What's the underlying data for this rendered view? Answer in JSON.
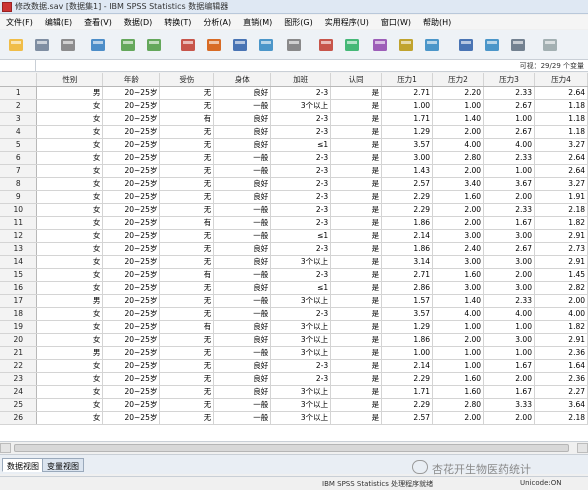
{
  "window": {
    "title": "修改数据.sav [数据集1] - IBM SPSS Statistics 数据编辑器"
  },
  "menu": [
    "文件(F)",
    "编辑(E)",
    "查看(V)",
    "数据(D)",
    "转换(T)",
    "分析(A)",
    "直销(M)",
    "图形(G)",
    "实用程序(U)",
    "窗口(W)",
    "帮助(H)"
  ],
  "toolbar": {
    "icons": [
      "open-icon",
      "save-icon",
      "print-icon",
      "dialog-recall-icon",
      "undo-icon",
      "redo-icon",
      "goto-case-icon",
      "goto-variable-icon",
      "variables-icon",
      "run-descriptives-icon",
      "find-icon",
      "insert-cases-icon",
      "insert-variable-icon",
      "split-file-icon",
      "weight-cases-icon",
      "select-cases-icon",
      "value-labels-icon",
      "use-sets-icon",
      "show-all-variables-icon",
      "spell-check-icon"
    ]
  },
  "infobar": {
    "visible_text": "可视：29/29 个变量"
  },
  "grid": {
    "columns": [
      "性别",
      "年龄",
      "受伤",
      "身体",
      "加班",
      "认同",
      "压力1",
      "压力2",
      "压力3",
      "压力4"
    ],
    "rows": [
      [
        "1",
        "男",
        "20~25岁",
        "无",
        "良好",
        "2-3",
        "是",
        "2.71",
        "2.20",
        "2.33",
        "2.64"
      ],
      [
        "2",
        "女",
        "20~25岁",
        "无",
        "一般",
        "3个以上",
        "是",
        "1.00",
        "1.00",
        "2.67",
        "1.18"
      ],
      [
        "3",
        "女",
        "20~25岁",
        "有",
        "良好",
        "2-3",
        "是",
        "1.71",
        "1.40",
        "1.00",
        "1.18"
      ],
      [
        "4",
        "女",
        "20~25岁",
        "无",
        "良好",
        "2-3",
        "是",
        "1.29",
        "2.00",
        "2.67",
        "1.18"
      ],
      [
        "5",
        "女",
        "20~25岁",
        "无",
        "良好",
        "≤1",
        "是",
        "3.57",
        "4.00",
        "4.00",
        "3.27"
      ],
      [
        "6",
        "女",
        "20~25岁",
        "无",
        "一般",
        "2-3",
        "是",
        "3.00",
        "2.80",
        "2.33",
        "2.64"
      ],
      [
        "7",
        "女",
        "20~25岁",
        "无",
        "一般",
        "2-3",
        "是",
        "1.43",
        "2.00",
        "1.00",
        "2.64"
      ],
      [
        "8",
        "女",
        "20~25岁",
        "无",
        "良好",
        "2-3",
        "是",
        "2.57",
        "3.40",
        "3.67",
        "3.27"
      ],
      [
        "9",
        "女",
        "20~25岁",
        "无",
        "良好",
        "2-3",
        "是",
        "2.29",
        "1.60",
        "2.00",
        "1.91"
      ],
      [
        "10",
        "女",
        "20~25岁",
        "无",
        "一般",
        "2-3",
        "是",
        "2.29",
        "2.00",
        "2.33",
        "2.18"
      ],
      [
        "11",
        "女",
        "20~25岁",
        "有",
        "一般",
        "2-3",
        "是",
        "1.86",
        "2.00",
        "1.67",
        "1.82"
      ],
      [
        "12",
        "女",
        "20~25岁",
        "无",
        "一般",
        "≤1",
        "是",
        "2.14",
        "3.00",
        "3.00",
        "2.91"
      ],
      [
        "13",
        "女",
        "20~25岁",
        "无",
        "良好",
        "2-3",
        "是",
        "1.86",
        "2.40",
        "2.67",
        "2.73"
      ],
      [
        "14",
        "女",
        "20~25岁",
        "无",
        "良好",
        "3个以上",
        "是",
        "3.14",
        "3.00",
        "3.00",
        "2.91"
      ],
      [
        "15",
        "女",
        "20~25岁",
        "有",
        "一般",
        "2-3",
        "是",
        "2.71",
        "1.60",
        "2.00",
        "1.45"
      ],
      [
        "16",
        "女",
        "20~25岁",
        "无",
        "良好",
        "≤1",
        "是",
        "2.86",
        "3.00",
        "3.00",
        "2.82"
      ],
      [
        "17",
        "男",
        "20~25岁",
        "无",
        "一般",
        "3个以上",
        "是",
        "1.57",
        "1.40",
        "2.33",
        "2.00"
      ],
      [
        "18",
        "女",
        "20~25岁",
        "无",
        "一般",
        "2-3",
        "是",
        "3.57",
        "4.00",
        "4.00",
        "4.00"
      ],
      [
        "19",
        "女",
        "20~25岁",
        "有",
        "良好",
        "3个以上",
        "是",
        "1.29",
        "1.00",
        "1.00",
        "1.82"
      ],
      [
        "20",
        "女",
        "20~25岁",
        "无",
        "良好",
        "3个以上",
        "是",
        "1.86",
        "2.00",
        "3.00",
        "2.91"
      ],
      [
        "21",
        "男",
        "20~25岁",
        "无",
        "一般",
        "3个以上",
        "是",
        "1.00",
        "1.00",
        "1.00",
        "2.36"
      ],
      [
        "22",
        "女",
        "20~25岁",
        "无",
        "良好",
        "2-3",
        "是",
        "2.14",
        "1.00",
        "1.67",
        "1.64"
      ],
      [
        "23",
        "女",
        "20~25岁",
        "无",
        "良好",
        "2-3",
        "是",
        "2.29",
        "1.60",
        "2.00",
        "2.36"
      ],
      [
        "24",
        "女",
        "20~25岁",
        "无",
        "良好",
        "3个以上",
        "是",
        "1.71",
        "1.60",
        "1.67",
        "2.27"
      ],
      [
        "25",
        "女",
        "20~25岁",
        "无",
        "一般",
        "3个以上",
        "是",
        "2.29",
        "2.80",
        "3.33",
        "3.64"
      ],
      [
        "26",
        "女",
        "20~25岁",
        "无",
        "一般",
        "3个以上",
        "是",
        "2.57",
        "2.00",
        "2.00",
        "2.18"
      ]
    ]
  },
  "tabs": {
    "data_view": "数据视图",
    "variable_view": "变量视图"
  },
  "status": {
    "processor": "IBM SPSS Statistics 处理程序就绪",
    "unicode": "Unicode:ON"
  },
  "watermark": "杏花开生物医药统计"
}
